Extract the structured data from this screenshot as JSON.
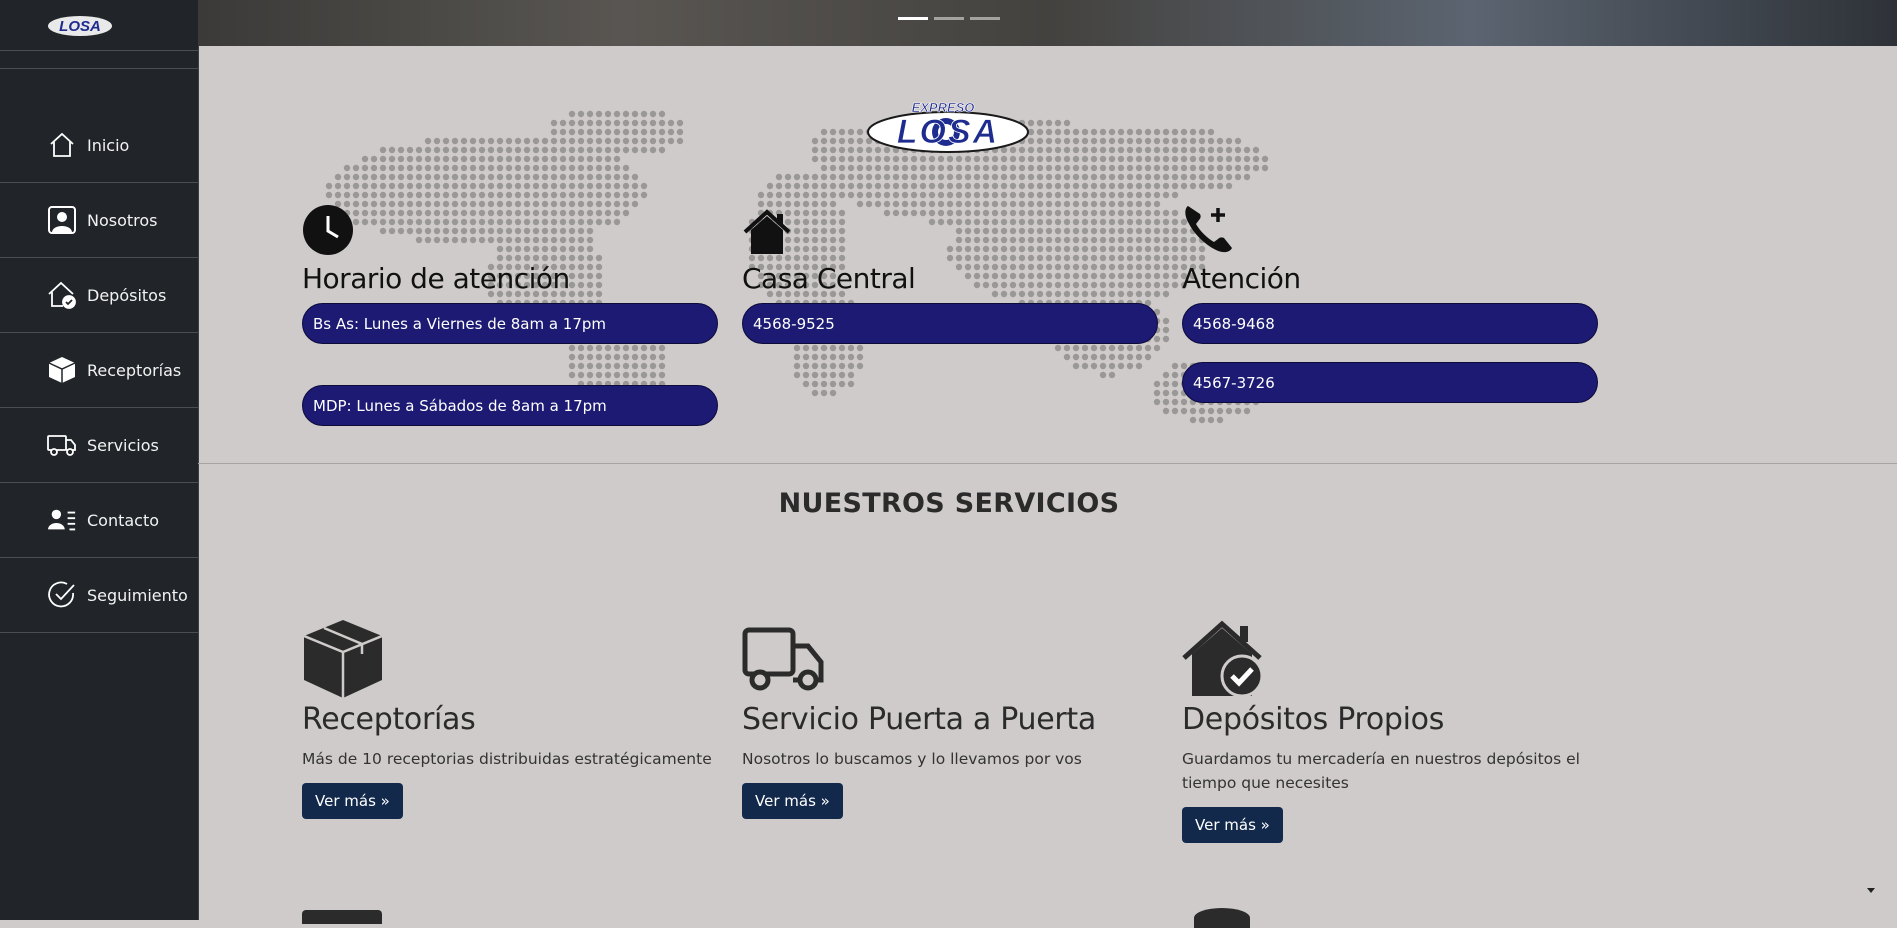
{
  "brand": {
    "logo_text": "LOSA",
    "logo_top_text": "EXPRESO"
  },
  "sidebar": {
    "items": [
      {
        "label": "Inicio",
        "icon": "home-icon"
      },
      {
        "label": "Nosotros",
        "icon": "person-icon"
      },
      {
        "label": "Depósitos",
        "icon": "house-check-icon"
      },
      {
        "label": "Receptorías",
        "icon": "box-icon"
      },
      {
        "label": "Servicios",
        "icon": "truck-icon"
      },
      {
        "label": "Contacto",
        "icon": "person-lines-icon"
      },
      {
        "label": "Seguimiento",
        "icon": "check-circle-icon"
      }
    ]
  },
  "carousel": {
    "indicator_count": 3,
    "active_index": 0
  },
  "info": {
    "horario": {
      "title": "Horario de atención",
      "icon": "clock-icon",
      "lines": [
        "Bs As: Lunes a Viernes de 8am a 17pm",
        "MDP: Lunes a Sábados de 8am a 17pm"
      ]
    },
    "casa_central": {
      "title": "Casa Central",
      "icon": "house-icon",
      "lines": [
        "4568-9525"
      ]
    },
    "atencion": {
      "title": "Atención",
      "icon": "phone-plus-icon",
      "lines": [
        "4568-9468",
        "4567-3726"
      ]
    }
  },
  "services": {
    "title": "NUESTROS SERVICIOS",
    "items": [
      {
        "title": "Receptorías",
        "description": "Más de 10 receptorias distribuidas estratégicamente",
        "button": "Ver más »",
        "icon": "box-icon"
      },
      {
        "title": "Servicio Puerta a Puerta",
        "description": "Nosotros lo buscamos y lo llevamos por vos",
        "button": "Ver más »",
        "icon": "truck-icon"
      },
      {
        "title": "Depósitos Propios",
        "description": "Guardamos tu mercadería en nuestros depósitos el tiempo que necesites",
        "button": "Ver más »",
        "icon": "house-check-icon"
      }
    ]
  },
  "colors": {
    "sidebar_bg": "#212529",
    "page_bg": "#d0cbcb",
    "pill_bg": "#1c1a73",
    "button_bg": "#13294b"
  }
}
